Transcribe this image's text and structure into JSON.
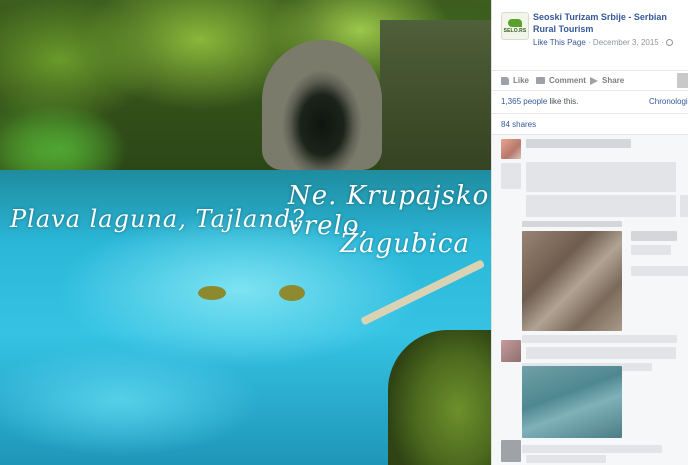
{
  "photo": {
    "caption_left": "Plava laguna, Tajland?",
    "caption_right_line1": "Ne. Krupajsko vrelo,",
    "caption_right_line2": "Žagubica"
  },
  "post": {
    "page_logo_text": "SELO.RS",
    "page_name": "Seoski Turizam Srbije - Serbian Rural Tourism",
    "like_this_page": "Like This Page",
    "separator": "·",
    "date": "December 3, 2015",
    "audience_icon": "globe-icon"
  },
  "actions": {
    "like": "Like",
    "comment": "Comment",
    "share": "Share",
    "like_icon": "thumbs-up-icon",
    "comment_icon": "comment-icon",
    "share_icon": "share-icon"
  },
  "likes": {
    "count_link": "1,365 people",
    "suffix": "like this.",
    "chronological": "Chronological"
  },
  "shares": "84 shares",
  "colors": {
    "link": "#365899",
    "meta_gray": "#90949c",
    "divider": "#e5e6e9",
    "comments_bg": "#f6f7f9"
  }
}
